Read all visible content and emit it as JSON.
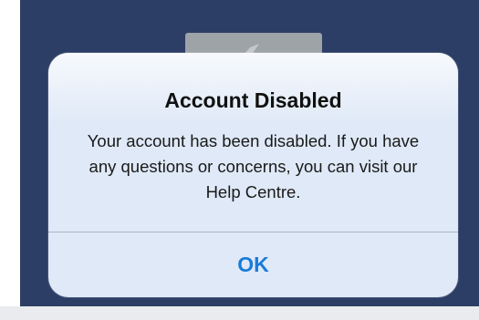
{
  "alert": {
    "title": "Account Disabled",
    "message": "Your account has been disabled. If you have any questions or concerns, you can visit our Help Centre.",
    "ok_label": "OK"
  },
  "colors": {
    "backdrop": "#2c3e65",
    "alert_background": "#dfe9f7",
    "ok_button_text": "#1a7bd8"
  }
}
